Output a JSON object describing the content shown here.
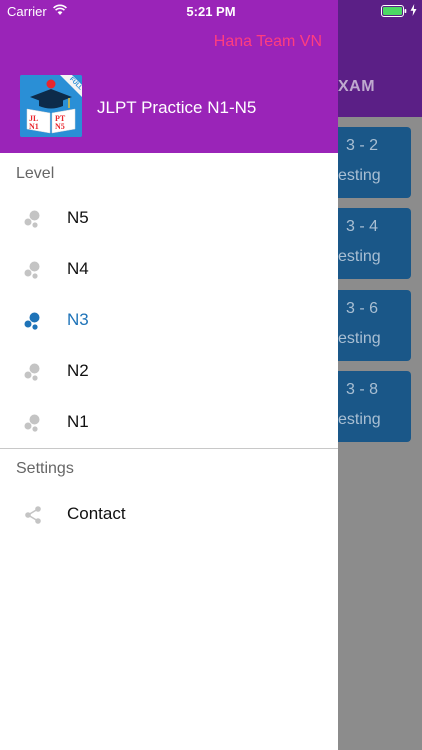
{
  "status_bar": {
    "carrier": "Carrier",
    "time": "5:21 PM"
  },
  "background": {
    "tab_label": "XAM",
    "cards": [
      {
        "line1": "3 - 2",
        "line2": "esting"
      },
      {
        "line1": "3 - 4",
        "line2": "esting"
      },
      {
        "line1": "3 - 6",
        "line2": "esting"
      },
      {
        "line1": "3 - 8",
        "line2": "esting"
      }
    ]
  },
  "drawer": {
    "team_name": "Hana Team VN",
    "app_title": "JLPT Practice N1-N5",
    "logo": {
      "badge": "FULL",
      "text_left": "JL N1",
      "text_right": "PT N5"
    },
    "level_section": "Level",
    "levels": [
      {
        "label": "N5",
        "icon": "bubbles-icon",
        "active": false
      },
      {
        "label": "N4",
        "icon": "bubbles-icon",
        "active": false
      },
      {
        "label": "N3",
        "icon": "bubbles-icon",
        "active": true
      },
      {
        "label": "N2",
        "icon": "bubbles-icon",
        "active": false
      },
      {
        "label": "N1",
        "icon": "bubbles-icon",
        "active": false
      }
    ],
    "settings_section": "Settings",
    "contact_label": "Contact"
  },
  "colors": {
    "drawer_header": "#9a24b8",
    "team_name": "#ff3d7f",
    "active": "#1e73b8",
    "inactive_icon": "#c4c4c4",
    "bg_header": "#5b1f86",
    "bg_card": "#1a5788"
  }
}
